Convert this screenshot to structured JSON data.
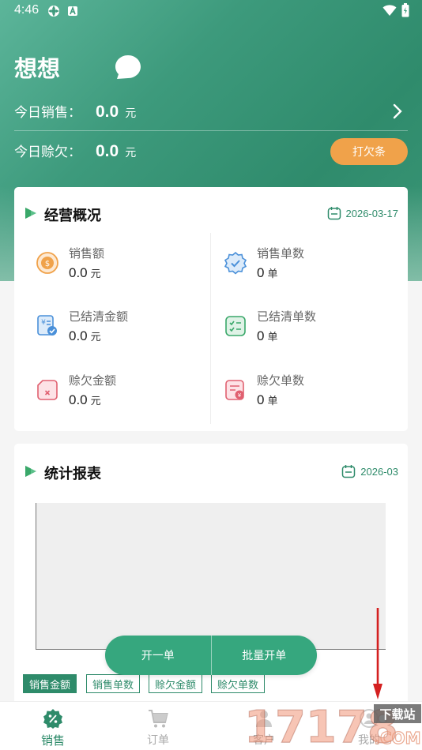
{
  "status_bar": {
    "time": "4:46"
  },
  "header": {
    "shop_name": "想想",
    "today_sales_label": "今日销售：",
    "today_sales_value": "0.0",
    "today_sales_unit": "元",
    "today_credit_label": "今日赊欠：",
    "today_credit_value": "0.0",
    "today_credit_unit": "元",
    "iou_button": "打欠条"
  },
  "overview": {
    "title": "经营概况",
    "date": "2026-03-17",
    "metrics": [
      {
        "label": "销售额",
        "value": "0.0",
        "unit": "元",
        "icon": "coin-icon",
        "color": "#f0a24a"
      },
      {
        "label": "销售单数",
        "value": "0",
        "unit": "单",
        "icon": "badge-check-icon",
        "color": "#4a90d9"
      },
      {
        "label": "已结清金额",
        "value": "0.0",
        "unit": "元",
        "icon": "invoice-paid-icon",
        "color": "#4a90d9"
      },
      {
        "label": "已结清单数",
        "value": "0",
        "unit": "单",
        "icon": "checklist-icon",
        "color": "#3aa86a"
      },
      {
        "label": "赊欠金额",
        "value": "0.0",
        "unit": "元",
        "icon": "credit-bill-icon",
        "color": "#e06070"
      },
      {
        "label": "赊欠单数",
        "value": "0",
        "unit": "单",
        "icon": "credit-orders-icon",
        "color": "#e06070"
      }
    ]
  },
  "report": {
    "title": "统计报表",
    "date": "2026-03",
    "tabs": [
      "销售金额",
      "销售单数",
      "赊欠金额",
      "赊欠单数"
    ],
    "active_tab": 0
  },
  "fab": {
    "new_order": "开一单",
    "batch_order": "批量开单"
  },
  "tabbar": {
    "items": [
      {
        "label": "销售",
        "icon": "sales-percent-icon",
        "active": true
      },
      {
        "label": "订单",
        "icon": "cart-icon",
        "active": false
      },
      {
        "label": "客户",
        "icon": "customer-icon",
        "active": false
      },
      {
        "label": "我的",
        "icon": "profile-icon",
        "active": false
      }
    ]
  },
  "watermark": {
    "text": "17178",
    "sub": "下载站",
    "domain": ".COM"
  },
  "colors": {
    "brand": "#2e8b6a",
    "accent": "#f0a24a",
    "annotation": "#d42020"
  }
}
